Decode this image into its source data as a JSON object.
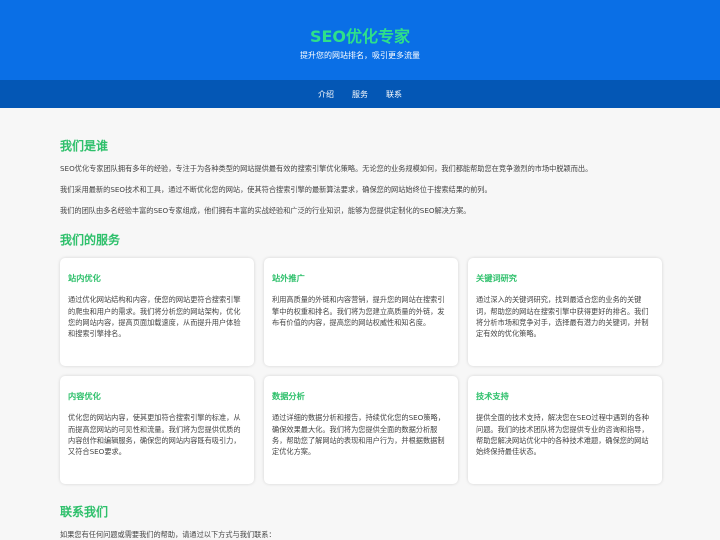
{
  "header": {
    "title": "SEO优化专家",
    "subtitle": "提升您的网站排名，吸引更多流量"
  },
  "nav": {
    "items": [
      "介绍",
      "服务",
      "联系"
    ]
  },
  "about": {
    "title": "我们是谁",
    "paragraphs": [
      "SEO优化专家团队拥有多年的经验，专注于为各种类型的网站提供最有效的搜索引擎优化策略。无论您的业务规模如何，我们都能帮助您在竞争激烈的市场中脱颖而出。",
      "我们采用最新的SEO技术和工具，通过不断优化您的网站，使其符合搜索引擎的最新算法要求，确保您的网站始终位于搜索结果的前列。",
      "我们的团队由多名经验丰富的SEO专家组成，他们拥有丰富的实战经验和广泛的行业知识，能够为您提供定制化的SEO解决方案。"
    ]
  },
  "services": {
    "title": "我们的服务",
    "cards": [
      {
        "title": "站内优化",
        "text": "通过优化网站结构和内容，使您的网站更符合搜索引擎的爬虫和用户的需求。我们将分析您的网站架构，优化您的网站内容，提高页面加载速度，从而提升用户体验和搜索引擎排名。"
      },
      {
        "title": "站外推广",
        "text": "利用高质量的外链和内容营销，提升您的网站在搜索引擎中的权重和排名。我们将为您建立高质量的外链，发布有价值的内容，提高您的网站权威性和知名度。"
      },
      {
        "title": "关键词研究",
        "text": "通过深入的关键词研究，找到最适合您的业务的关键词，帮助您的网站在搜索引擎中获得更好的排名。我们将分析市场和竞争对手，选择最有潜力的关键词，并制定有效的优化策略。"
      },
      {
        "title": "内容优化",
        "text": "优化您的网站内容，使其更加符合搜索引擎的标准，从而提高您网站的可见性和流量。我们将为您提供优质的内容创作和编辑服务，确保您的网站内容既有吸引力，又符合SEO要求。"
      },
      {
        "title": "数据分析",
        "text": "通过详细的数据分析和报告，持续优化您的SEO策略，确保效果最大化。我们将为您提供全面的数据分析服务，帮助您了解网站的表现和用户行为，并根据数据制定优化方案。"
      },
      {
        "title": "技术支持",
        "text": "提供全面的技术支持，解决您在SEO过程中遇到的各种问题。我们的技术团队将为您提供专业的咨询和指导，帮助您解决网站优化中的各种技术难题，确保您的网站始终保持最佳状态。"
      }
    ]
  },
  "contact": {
    "title": "联系我们",
    "intro": "如果您有任何问题或需要我们的帮助，请通过以下方式与我们联系："
  }
}
